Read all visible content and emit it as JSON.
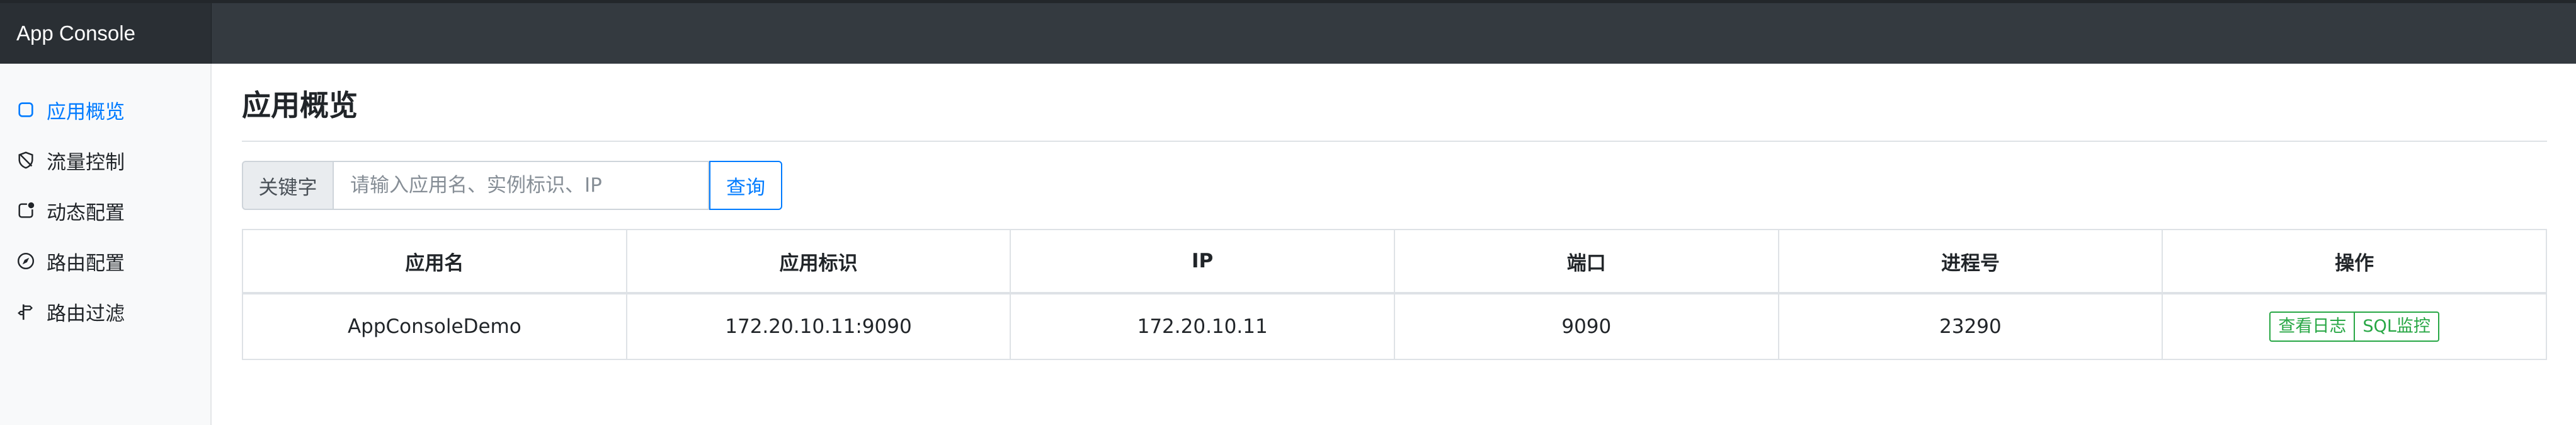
{
  "app": {
    "title": "App Console"
  },
  "sidebar": {
    "items": [
      {
        "label": "应用概览",
        "icon": "square-icon",
        "active": true
      },
      {
        "label": "流量控制",
        "icon": "shield-icon"
      },
      {
        "label": "动态配置",
        "icon": "badge-square-icon"
      },
      {
        "label": "路由配置",
        "icon": "compass-icon"
      },
      {
        "label": "路由过滤",
        "icon": "signpost-icon"
      }
    ]
  },
  "main": {
    "title": "应用概览",
    "search": {
      "prefix": "关键字",
      "placeholder": "请输入应用名、实例标识、IP",
      "button": "查询"
    },
    "table": {
      "headers": [
        "应用名",
        "应用标识",
        "IP",
        "端口",
        "进程号",
        "操作"
      ],
      "rows": [
        {
          "app_name": "AppConsoleDemo",
          "app_id": "172.20.10.11:9090",
          "ip": "172.20.10.11",
          "port": "9090",
          "pid": "23290",
          "actions": [
            "查看日志",
            "SQL监控"
          ]
        }
      ]
    }
  },
  "colors": {
    "accent": "#007bff",
    "success": "#28a745",
    "topbar": "#343a40"
  }
}
